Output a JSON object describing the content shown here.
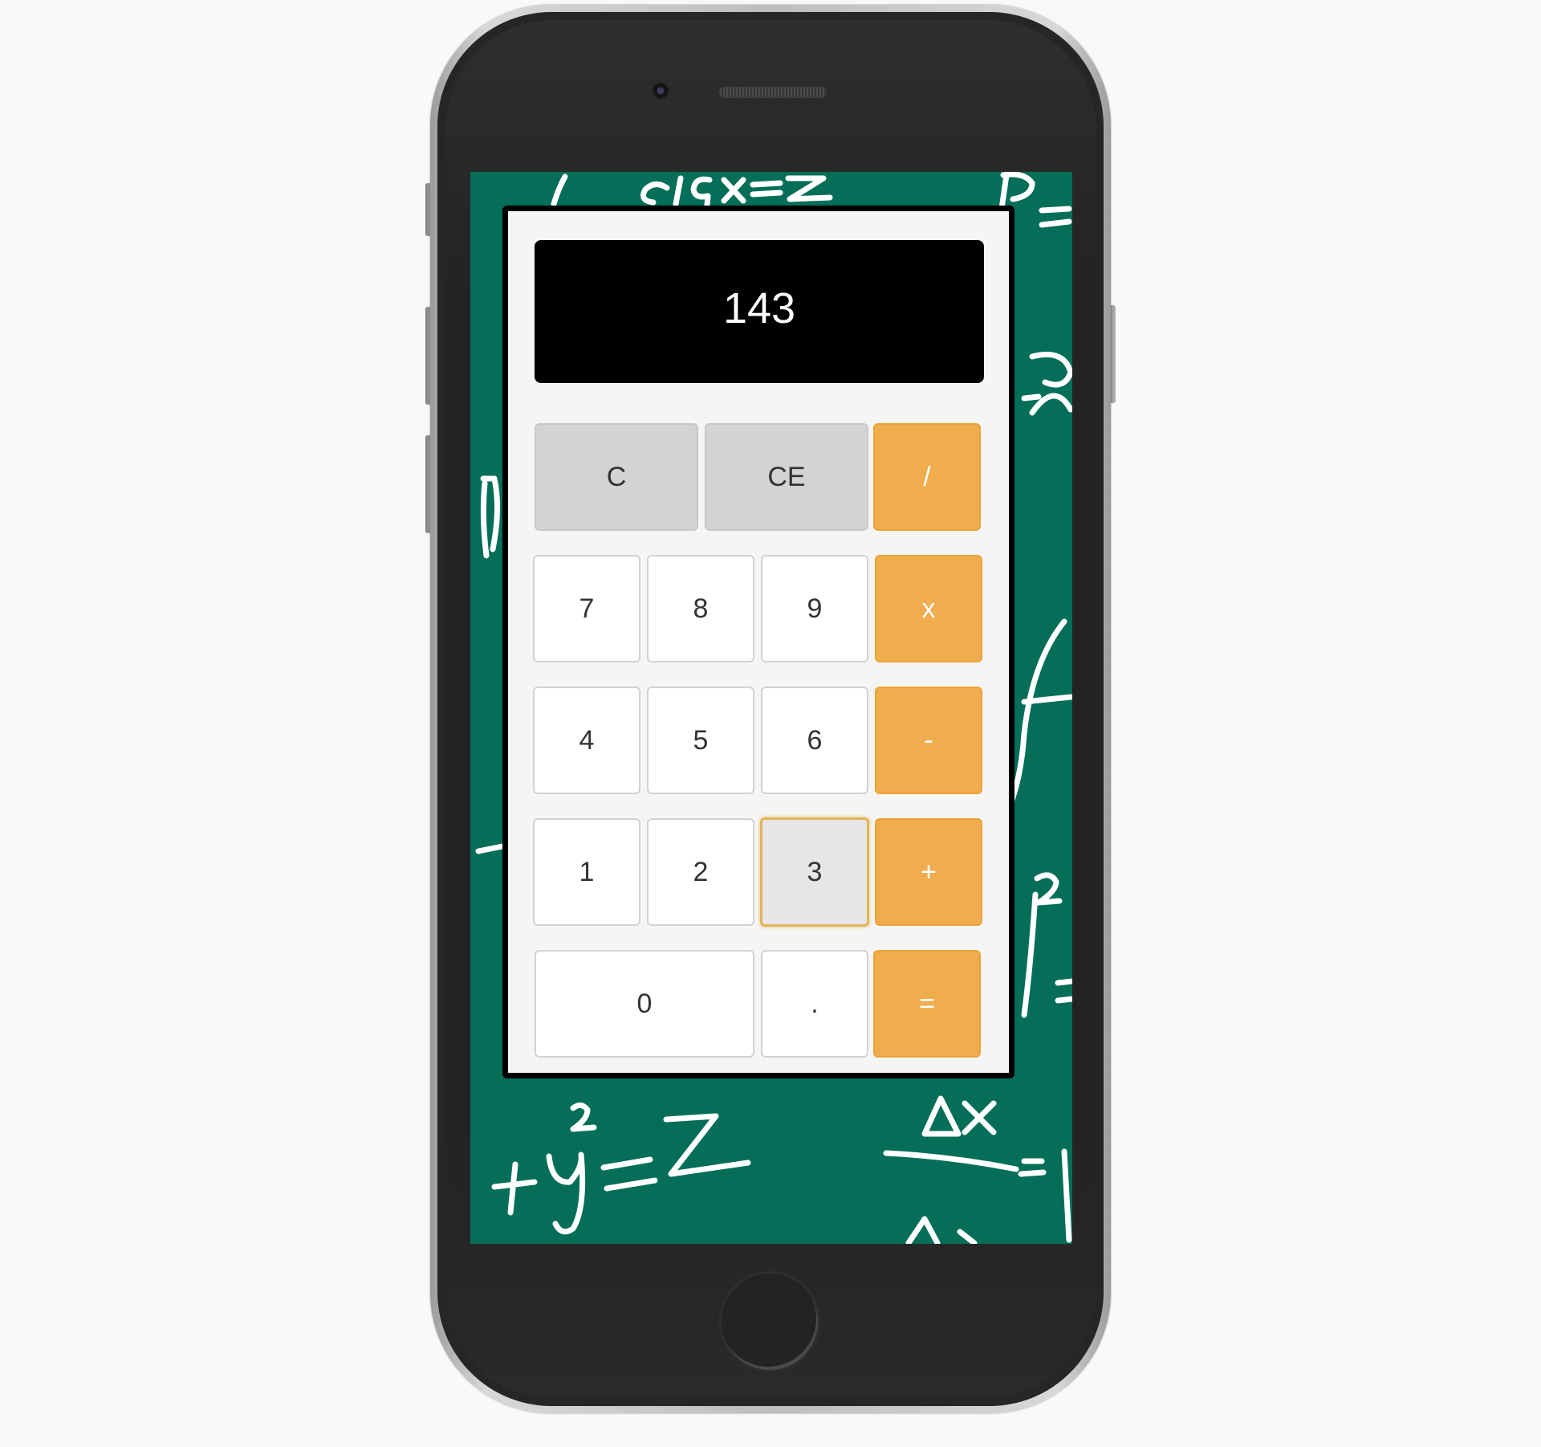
{
  "calculator": {
    "display_value": "143",
    "keys": {
      "clear": "C",
      "clear_entry": "CE",
      "divide": "/",
      "seven": "7",
      "eight": "8",
      "nine": "9",
      "multiply": "x",
      "four": "4",
      "five": "5",
      "six": "6",
      "subtract": "-",
      "one": "1",
      "two": "2",
      "three": "3",
      "add": "+",
      "zero": "0",
      "decimal": ".",
      "equals": "="
    },
    "pressed_key": "3"
  },
  "colors": {
    "chalkboard": "#046e58",
    "operator": "#f0ad4e",
    "function_key": "#d3d3d3",
    "display": "#000000"
  },
  "background_chalk_text": {
    "top": "e^lgx=Z",
    "bottom_left": "+y²=Z",
    "bottom_right": "Δx"
  }
}
